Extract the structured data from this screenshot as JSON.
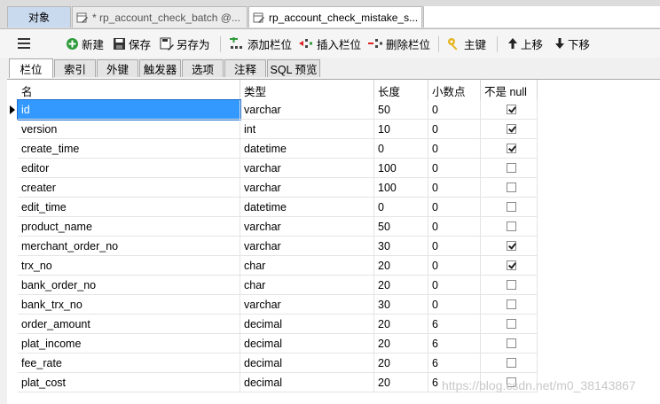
{
  "tabs": {
    "objects": "对象",
    "tab_a": "* rp_account_check_batch @...",
    "tab_b": "rp_account_check_mistake_s..."
  },
  "toolbar": {
    "new": "新建",
    "save": "保存",
    "save_as": "另存为",
    "add_field": "添加栏位",
    "insert_field": "插入栏位",
    "delete_field": "删除栏位",
    "primary_key": "主键",
    "move_up": "上移",
    "move_down": "下移"
  },
  "subtabs": [
    "栏位",
    "索引",
    "外键",
    "触发器",
    "选项",
    "注释",
    "SQL 预览"
  ],
  "columns": {
    "name": "名",
    "type": "类型",
    "length": "长度",
    "decimals": "小数点",
    "not_null": "不是 null"
  },
  "rows": [
    {
      "name": "id",
      "type": "varchar",
      "length": "50",
      "decimals": "0",
      "not_null": true
    },
    {
      "name": "version",
      "type": "int",
      "length": "10",
      "decimals": "0",
      "not_null": true
    },
    {
      "name": "create_time",
      "type": "datetime",
      "length": "0",
      "decimals": "0",
      "not_null": true
    },
    {
      "name": "editor",
      "type": "varchar",
      "length": "100",
      "decimals": "0",
      "not_null": false
    },
    {
      "name": "creater",
      "type": "varchar",
      "length": "100",
      "decimals": "0",
      "not_null": false
    },
    {
      "name": "edit_time",
      "type": "datetime",
      "length": "0",
      "decimals": "0",
      "not_null": false
    },
    {
      "name": "product_name",
      "type": "varchar",
      "length": "50",
      "decimals": "0",
      "not_null": false
    },
    {
      "name": "merchant_order_no",
      "type": "varchar",
      "length": "30",
      "decimals": "0",
      "not_null": true
    },
    {
      "name": "trx_no",
      "type": "char",
      "length": "20",
      "decimals": "0",
      "not_null": true
    },
    {
      "name": "bank_order_no",
      "type": "char",
      "length": "20",
      "decimals": "0",
      "not_null": false
    },
    {
      "name": "bank_trx_no",
      "type": "varchar",
      "length": "30",
      "decimals": "0",
      "not_null": false
    },
    {
      "name": "order_amount",
      "type": "decimal",
      "length": "20",
      "decimals": "6",
      "not_null": false
    },
    {
      "name": "plat_income",
      "type": "decimal",
      "length": "20",
      "decimals": "6",
      "not_null": false
    },
    {
      "name": "fee_rate",
      "type": "decimal",
      "length": "20",
      "decimals": "6",
      "not_null": false
    },
    {
      "name": "plat_cost",
      "type": "decimal",
      "length": "20",
      "decimals": "6",
      "not_null": false
    }
  ],
  "watermark": "https://blog.csdn.net/m0_38143867"
}
